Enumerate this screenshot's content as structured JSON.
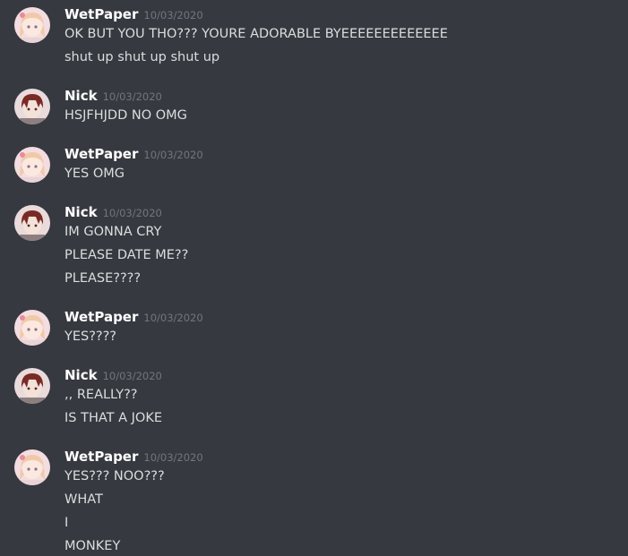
{
  "messages": [
    {
      "author": "WetPaper",
      "avatar": "wetpaper-avatar",
      "timestamp": "10/03/2020",
      "lines": [
        "OK BUT YOU THO??? YOURE ADORABLE BYEEEEEEEEEEEEE",
        "shut up shut up shut up"
      ]
    },
    {
      "author": "Nick",
      "avatar": "nick-avatar",
      "timestamp": "10/03/2020",
      "lines": [
        "HSJFHJDD NO OMG"
      ]
    },
    {
      "author": "WetPaper",
      "avatar": "wetpaper-avatar",
      "timestamp": "10/03/2020",
      "lines": [
        "YES OMG"
      ]
    },
    {
      "author": "Nick",
      "avatar": "nick-avatar",
      "timestamp": "10/03/2020",
      "lines": [
        "IM GONNA CRY",
        "PLEASE DATE ME??",
        "PLEASE????"
      ]
    },
    {
      "author": "WetPaper",
      "avatar": "wetpaper-avatar",
      "timestamp": "10/03/2020",
      "lines": [
        "YES????"
      ]
    },
    {
      "author": "Nick",
      "avatar": "nick-avatar",
      "timestamp": "10/03/2020",
      "lines": [
        ",, REALLY??",
        "IS THAT A JOKE"
      ]
    },
    {
      "author": "WetPaper",
      "avatar": "wetpaper-avatar",
      "timestamp": "10/03/2020",
      "lines": [
        "YES??? NOO???",
        "WHAT",
        "I",
        "MONKEY"
      ]
    }
  ],
  "colors": {
    "background": "#36393f",
    "username": "#ffffff",
    "timestamp": "#72767d",
    "text": "#dcddde"
  }
}
